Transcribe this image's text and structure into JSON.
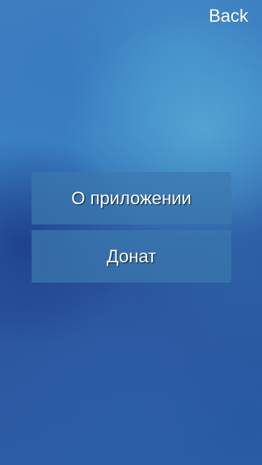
{
  "header": {
    "back_label": "Back"
  },
  "menu": {
    "items": [
      {
        "label": "О приложении"
      },
      {
        "label": "Донат"
      }
    ]
  }
}
